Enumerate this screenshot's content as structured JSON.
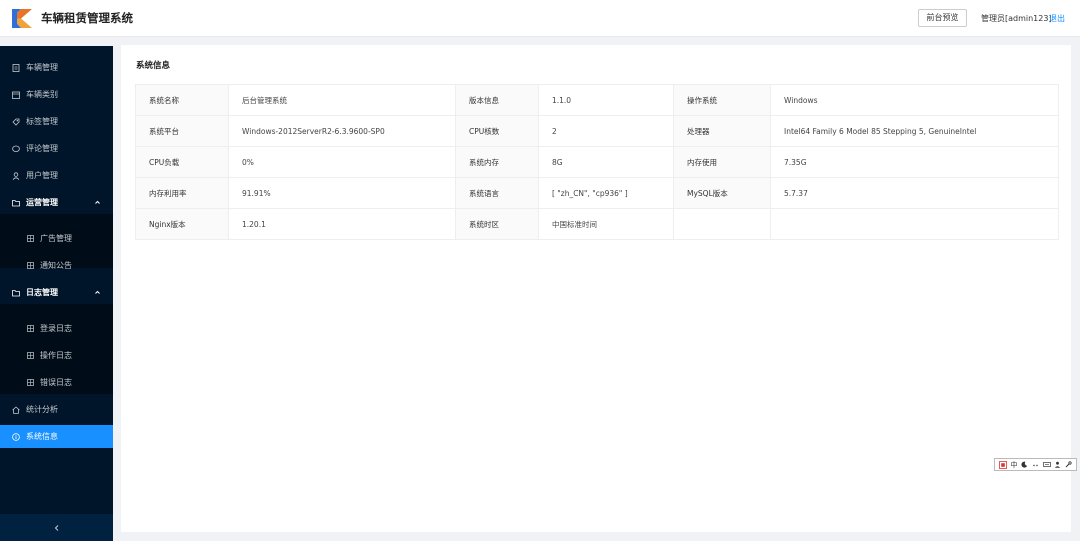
{
  "header": {
    "title": "车辆租赁管理系统",
    "preview_button": "前台预览",
    "admin": "管理员[admin123]",
    "logout": "退出"
  },
  "sidebar": {
    "items": [
      {
        "label": "车辆管理",
        "icon": "document-icon"
      },
      {
        "label": "车辆类别",
        "icon": "calendar-icon"
      },
      {
        "label": "标签管理",
        "icon": "tag-icon"
      },
      {
        "label": "评论管理",
        "icon": "comment-icon"
      },
      {
        "label": "用户管理",
        "icon": "user-icon"
      }
    ],
    "groups": [
      {
        "label": "运营管理",
        "icon": "folder-icon",
        "children": [
          "广告管理",
          "通知公告"
        ]
      },
      {
        "label": "日志管理",
        "icon": "folder-icon",
        "children": [
          "登录日志",
          "操作日志",
          "错误日志"
        ]
      }
    ],
    "bottom_items": [
      {
        "label": "统计分析",
        "icon": "home-icon"
      },
      {
        "label": "系统信息",
        "icon": "info-icon",
        "active": true
      }
    ],
    "collapse_icon": "chevron-left-icon"
  },
  "panel": {
    "title": "系统信息",
    "rows": [
      [
        {
          "label": "系统名称",
          "value": "后台管理系统"
        },
        {
          "label": "版本信息",
          "value": "1.1.0"
        },
        {
          "label": "操作系统",
          "value": "Windows"
        }
      ],
      [
        {
          "label": "系统平台",
          "value": "Windows-2012ServerR2-6.3.9600-SP0"
        },
        {
          "label": "CPU核数",
          "value": "2"
        },
        {
          "label": "处理器",
          "value": "Intel64 Family 6 Model 85 Stepping 5, GenuineIntel"
        }
      ],
      [
        {
          "label": "CPU负载",
          "value": "0%"
        },
        {
          "label": "系统内存",
          "value": "8G"
        },
        {
          "label": "内存使用",
          "value": "7.35G"
        }
      ],
      [
        {
          "label": "内存利用率",
          "value": "91.91%"
        },
        {
          "label": "系统语言",
          "value": "[ \"zh_CN\", \"cp936\" ]"
        },
        {
          "label": "MySQL版本",
          "value": "5.7.37"
        }
      ],
      [
        {
          "label": "Nginx版本",
          "value": "1.20.1"
        },
        {
          "label": "系统时区",
          "value": "中国标准时间"
        },
        {
          "label": "",
          "value": ""
        }
      ]
    ]
  },
  "ime_toolbar": {
    "mode": "中"
  },
  "colors": {
    "sidebar_bg": "#001529",
    "submenu_bg": "#000c17",
    "accent": "#1890ff"
  }
}
